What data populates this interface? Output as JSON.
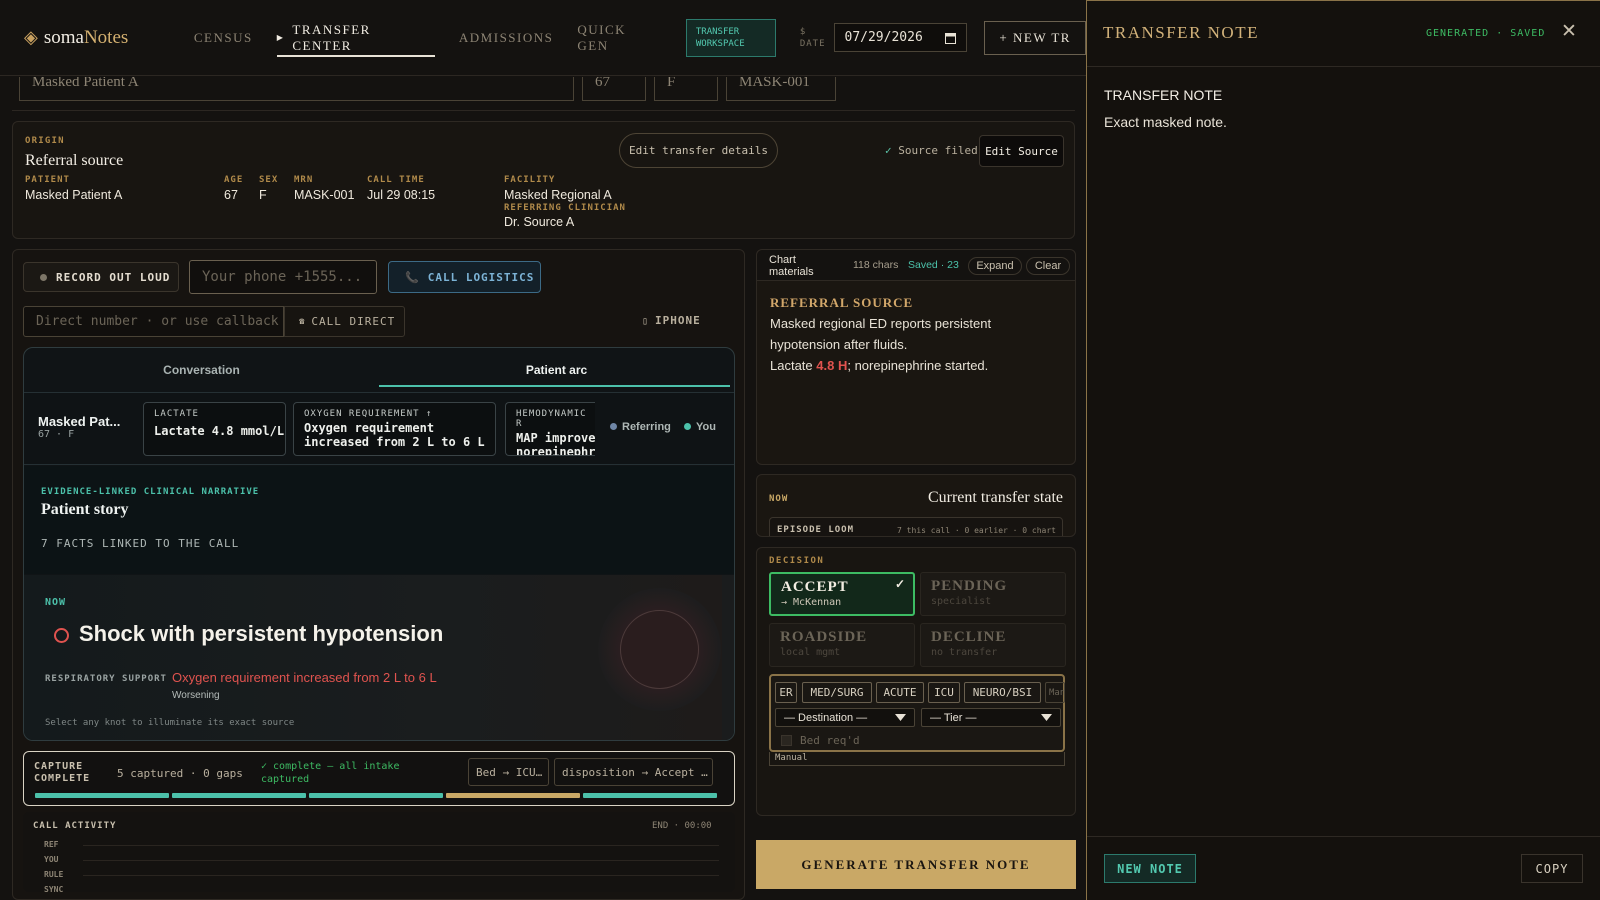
{
  "app": {
    "logo_a": "soma",
    "logo_b": "Notes"
  },
  "nav": {
    "tabs": [
      "CENSUS",
      "TRANSFER CENTER",
      "ADMISSIONS",
      "QUICK GEN"
    ],
    "active": "TRANSFER CENTER"
  },
  "workspace_badge": "TRANSFER WORKSPACE",
  "date": {
    "label_top": "$",
    "label": "DATE",
    "value": "07/29/2026"
  },
  "new_transfer_label": "+ NEW TR",
  "stub": {
    "name": "Masked Patient A",
    "age": "67",
    "sex": "F",
    "mrn": "MASK-001"
  },
  "origin": {
    "kicker": "ORIGIN",
    "title": "Referral source",
    "edit_details": "Edit transfer details",
    "source_filed": "Source filed",
    "edit_source": "Edit Source",
    "fields": {
      "patient_label": "PATIENT",
      "patient": "Masked Patient A",
      "age_label": "AGE",
      "age": "67",
      "sex_label": "SEX",
      "sex": "F",
      "mrn_label": "MRN",
      "mrn": "MASK-001",
      "call_time_label": "CALL TIME",
      "call_time": "Jul 29 08:15",
      "facility_label": "FACILITY",
      "facility": "Masked Regional A",
      "clinician_label": "REFERRING CLINICIAN",
      "clinician": "Dr. Source A"
    }
  },
  "call": {
    "record_label": "RECORD OUT LOUD",
    "phone_placeholder": "Your phone +1555...",
    "call_logistics": "CALL LOGISTICS",
    "direct_placeholder": "Direct number · or use callback",
    "call_direct": "CALL DIRECT",
    "iphone": "IPHONE"
  },
  "convo": {
    "tabs": [
      "Conversation",
      "Patient arc"
    ],
    "active_tab": "Patient arc",
    "patient_name": "Masked Pat...",
    "patient_meta": "67 · F",
    "chips": [
      {
        "label": "LACTATE",
        "value": "Lactate 4.8 mmol/L"
      },
      {
        "label": "OXYGEN REQUIREMENT ↑",
        "value": "Oxygen requirement increased from 2 L to 6 L"
      },
      {
        "label": "HEMODYNAMIC R",
        "value": "MAP improved norepinephri"
      }
    ],
    "legend": [
      {
        "label": "Referring",
        "color": "#6f86a6"
      },
      {
        "label": "You",
        "color": "#4cc1aa"
      }
    ],
    "story_kicker": "EVIDENCE-LINKED CLINICAL NARRATIVE",
    "story_title": "Patient story",
    "story_facts": "7 FACTS LINKED TO THE CALL",
    "now_label": "NOW",
    "now_title": "Shock with persistent hypotension",
    "resp_label": "RESPIRATORY SUPPORT",
    "resp_value": "Oxygen requirement increased from 2 L to 6 L",
    "resp_trend": "Worsening",
    "hint": "Select any knot to illuminate its exact source"
  },
  "capture": {
    "title_a": "CAPTURE",
    "title_b": "COMPLETE",
    "stats": "5 captured · 0 gaps",
    "status_a": "✓ complete — all intake",
    "status_b": "captured",
    "tag1": "Bed → ICU…",
    "tag2": "disposition → Accept …",
    "bars": [
      {
        "color": "#4cc1aa"
      },
      {
        "color": "#4cc1aa"
      },
      {
        "color": "#4cc1aa"
      },
      {
        "color": "#c9a866"
      },
      {
        "color": "#4cc1aa"
      }
    ]
  },
  "activity": {
    "title": "CALL ACTIVITY",
    "end": "END · 00:00",
    "rows": [
      "REF",
      "YOU",
      "RULE",
      "SYNC"
    ]
  },
  "chart_materials": {
    "title_a": "Chart",
    "title_b": "materials",
    "chars": "118 chars",
    "saved": "Saved · 23",
    "expand": "Expand",
    "clear": "Clear",
    "section": "REFERRAL SOURCE",
    "line1": "Masked regional ED reports persistent hypotension after fluids.",
    "line2_pre": "Lactate ",
    "line2_hi": "4.8 H",
    "line2_post": "; norepinephrine started."
  },
  "current_state": {
    "now": "NOW",
    "title": "Current transfer state",
    "loom": "EPISODE LOOM",
    "loom_meta": "7 this call · 0 earlier · 0 chart"
  },
  "decision": {
    "kicker": "DECISION",
    "cards": [
      {
        "title": "ACCEPT",
        "sub": "→ McKennan",
        "selected": true
      },
      {
        "title": "PENDING",
        "sub": "specialist",
        "selected": false
      },
      {
        "title": "ROADSIDE",
        "sub": "local mgmt",
        "selected": false
      },
      {
        "title": "DECLINE",
        "sub": "no transfer",
        "selected": false
      }
    ],
    "units": [
      "ER",
      "MED/SURG",
      "ACUTE",
      "ICU",
      "NEURO/BSI",
      "Manu"
    ],
    "destination": "— Destination —",
    "tier": "— Tier —",
    "bed": "Bed req'd",
    "manual": "Manual"
  },
  "generate_label": "GENERATE TRANSFER NOTE",
  "drawer": {
    "title": "TRANSFER NOTE",
    "status": "GENERATED · SAVED",
    "note_title": "TRANSFER NOTE",
    "note_body": "Exact masked note.",
    "new_note": "NEW NOTE",
    "copy": "COPY"
  },
  "colors": {
    "accent_gold": "#c9a866",
    "accent_teal": "#4cc1aa",
    "accept_green": "#3dbb63",
    "alert_red": "#e0534f"
  }
}
